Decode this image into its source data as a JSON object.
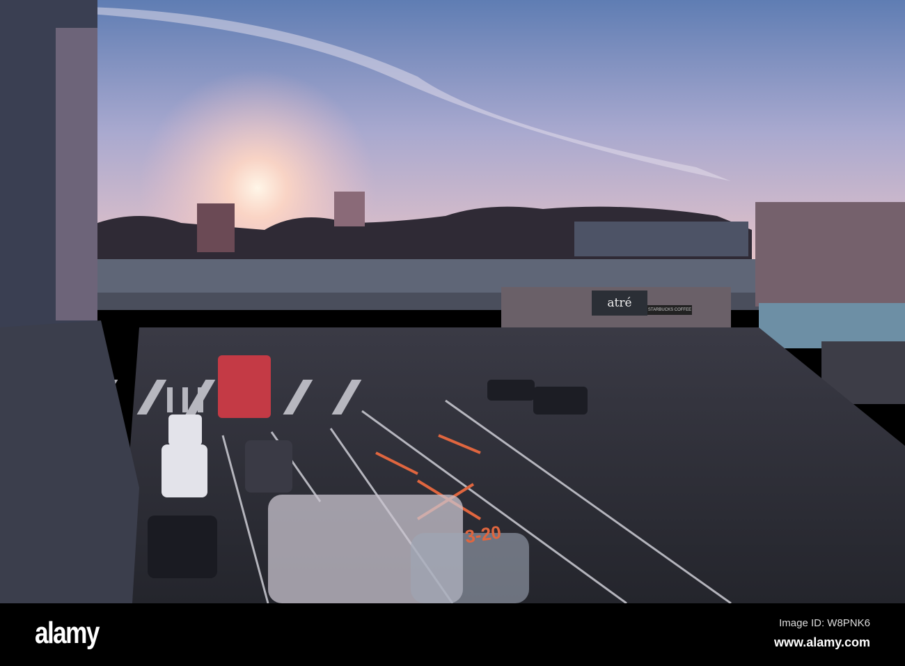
{
  "photo": {
    "description_alt": "Ueno station crossing at sunset",
    "station_sign": "atré",
    "cafe_sign": "STARBUCKS COFFEE",
    "road_marking": "3-20"
  },
  "watermark": {
    "logo": "alamy",
    "image_id": "Image ID: W8PNK6",
    "site": "www.alamy.com"
  },
  "colors": {
    "sky_top": "#6c86b8",
    "sky_glow": "#f4c9c4",
    "road": "#2d2c33",
    "footer": "#000000"
  }
}
